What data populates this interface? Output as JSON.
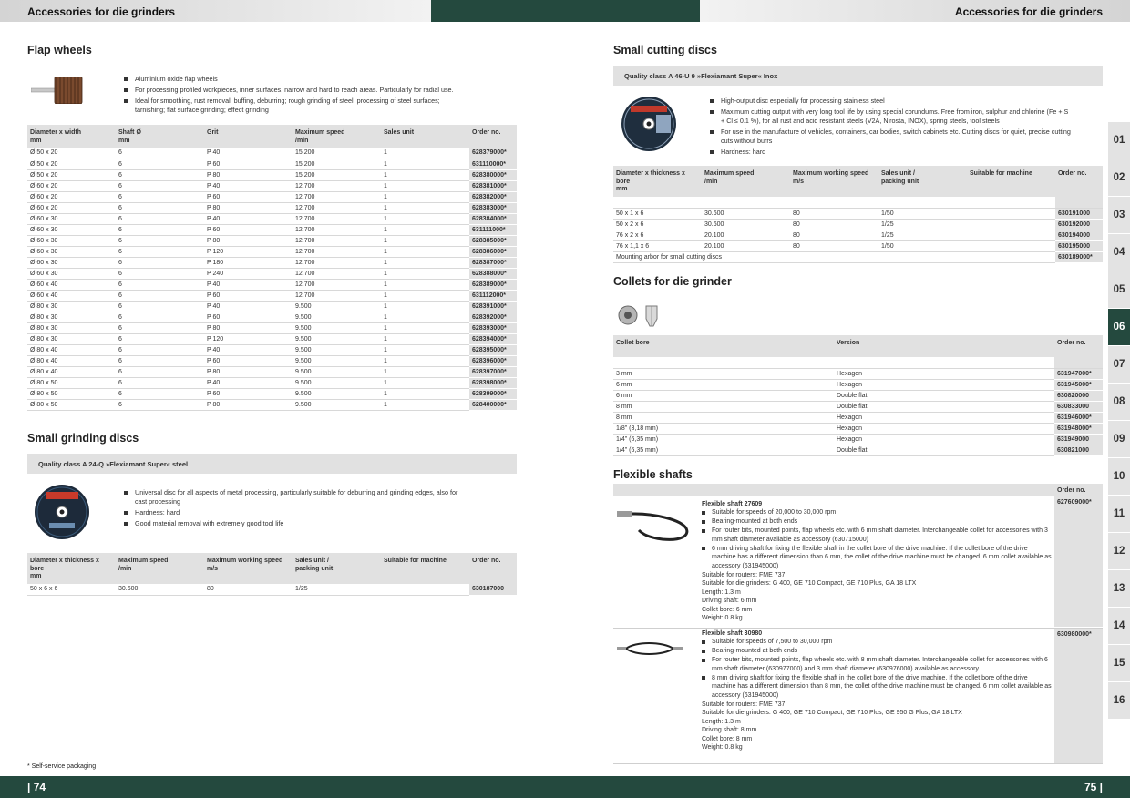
{
  "header": {
    "left_title": "Accessories for die grinders",
    "right_title": "Accessories for die grinders"
  },
  "footer": {
    "left_page": "| 74",
    "right_page": "75 |",
    "footnote": "* Self-service packaging"
  },
  "side_tabs": {
    "items": [
      "01",
      "02",
      "03",
      "04",
      "05",
      "06",
      "07",
      "08",
      "09",
      "10",
      "11",
      "12",
      "13",
      "14",
      "15",
      "16"
    ],
    "active": "06"
  },
  "flap_wheels": {
    "title": "Flap wheels",
    "bullets": [
      "Aluminium oxide flap wheels",
      "For processing profiled workpieces, inner surfaces, narrow and hard to reach areas. Particularly for radial use.",
      "Ideal for smoothing, rust removal, buffing, deburring; rough grinding of steel; processing of steel surfaces; tarnishing; flat surface grinding; effect grinding"
    ],
    "columns": [
      "Diameter x width\nmm",
      "Shaft Ø\nmm",
      "Grit",
      "Maximum speed\n/min",
      "Sales unit",
      "Order no."
    ],
    "rows": [
      [
        "Ø 50 x 20",
        "6",
        "P 40",
        "15.200",
        "1",
        "628379000*"
      ],
      [
        "Ø 50 x 20",
        "6",
        "P 60",
        "15.200",
        "1",
        "631110000*"
      ],
      [
        "Ø 50 x 20",
        "6",
        "P 80",
        "15.200",
        "1",
        "628380000*"
      ],
      [
        "Ø 60 x 20",
        "6",
        "P 40",
        "12.700",
        "1",
        "628381000*"
      ],
      [
        "Ø 60 x 20",
        "6",
        "P 60",
        "12.700",
        "1",
        "628382000*"
      ],
      [
        "Ø 60 x 20",
        "6",
        "P 80",
        "12.700",
        "1",
        "628383000*"
      ],
      [
        "Ø 60 x 30",
        "6",
        "P 40",
        "12.700",
        "1",
        "628384000*"
      ],
      [
        "Ø 60 x 30",
        "6",
        "P 60",
        "12.700",
        "1",
        "631111000*"
      ],
      [
        "Ø 60 x 30",
        "6",
        "P 80",
        "12.700",
        "1",
        "628385000*"
      ],
      [
        "Ø 60 x 30",
        "6",
        "P 120",
        "12.700",
        "1",
        "628386000*"
      ],
      [
        "Ø 60 x 30",
        "6",
        "P 180",
        "12.700",
        "1",
        "628387000*"
      ],
      [
        "Ø 60 x 30",
        "6",
        "P 240",
        "12.700",
        "1",
        "628388000*"
      ],
      [
        "Ø 60 x 40",
        "6",
        "P 40",
        "12.700",
        "1",
        "628389000*"
      ],
      [
        "Ø 60 x 40",
        "6",
        "P 60",
        "12.700",
        "1",
        "631112000*"
      ],
      [
        "Ø 80 x 30",
        "6",
        "P 40",
        "9.500",
        "1",
        "628391000*"
      ],
      [
        "Ø 80 x 30",
        "6",
        "P 60",
        "9.500",
        "1",
        "628392000*"
      ],
      [
        "Ø 80 x 30",
        "6",
        "P 80",
        "9.500",
        "1",
        "628393000*"
      ],
      [
        "Ø 80 x 30",
        "6",
        "P 120",
        "9.500",
        "1",
        "628394000*"
      ],
      [
        "Ø 80 x 40",
        "6",
        "P 40",
        "9.500",
        "1",
        "628395000*"
      ],
      [
        "Ø 80 x 40",
        "6",
        "P 60",
        "9.500",
        "1",
        "628396000*"
      ],
      [
        "Ø 80 x 40",
        "6",
        "P 80",
        "9.500",
        "1",
        "628397000*"
      ],
      [
        "Ø 80 x 50",
        "6",
        "P 40",
        "9.500",
        "1",
        "628398000*"
      ],
      [
        "Ø 80 x 50",
        "6",
        "P 60",
        "9.500",
        "1",
        "628399000*"
      ],
      [
        "Ø 80 x 50",
        "6",
        "P 80",
        "9.500",
        "1",
        "628400000*"
      ]
    ]
  },
  "small_grinding_discs": {
    "title": "Small grinding discs",
    "quality": "Quality class A 24-Q »Flexiamant Super« steel",
    "bullets": [
      "Universal disc for all aspects of metal processing, particularly suitable for deburring and grinding edges, also for cast processing",
      "Hardness: hard",
      "Good material removal with extremely good tool life"
    ],
    "columns": [
      "Diameter x thickness x\nbore\nmm",
      "Maximum speed\n/min",
      "Maximum working speed\nm/s",
      "Sales unit /\npacking unit",
      "Suitable for machine",
      "Order no."
    ],
    "rows": [
      [
        "50 x 6 x 6",
        "30.600",
        "80",
        "1/25",
        "",
        "630187000"
      ]
    ]
  },
  "small_cutting_discs": {
    "title": "Small cutting discs",
    "quality": "Quality class A 46-U 9 »Flexiamant Super« Inox",
    "bullets": [
      "High-output disc especially for processing stainless steel",
      "Maximum cutting output with very long tool life by using special corundums. Free from iron, sulphur and chlorine (Fe + S + Cl ≤ 0.1 %), for all rust and acid resistant steels (V2A, Nirosta, INOX), spring steels, tool steels",
      "For use in the manufacture of vehicles, containers, car bodies, switch cabinets etc. Cutting discs for quiet, precise cutting cuts without burrs",
      "Hardness: hard"
    ],
    "columns": [
      "Diameter x thickness x\nbore\nmm",
      "Maximum speed\n/min",
      "Maximum working speed\nm/s",
      "Sales unit /\npacking unit",
      "Suitable for machine",
      "Order no."
    ],
    "rows": [
      [
        "50 x 1 x 6",
        "30.600",
        "80",
        "1/50",
        "",
        "630191000"
      ],
      [
        "50 x 2 x 6",
        "30.600",
        "80",
        "1/25",
        "",
        "630192000"
      ],
      [
        "76 x 2 x 6",
        "20.100",
        "80",
        "1/25",
        "",
        "630194000"
      ],
      [
        "76 x 1,1 x 6",
        "20.100",
        "80",
        "1/50",
        "",
        "630195000"
      ]
    ],
    "arbor_label": "Mounting arbor for small cutting discs",
    "arbor_order": "630189000*"
  },
  "collets": {
    "title": "Collets for die grinder",
    "columns": [
      "Collet bore",
      "Version",
      "Order no."
    ],
    "rows": [
      [
        "3 mm",
        "Hexagon",
        "631947000*"
      ],
      [
        "6 mm",
        "Hexagon",
        "631945000*"
      ],
      [
        "6 mm",
        "Double flat",
        "630820000"
      ],
      [
        "8 mm",
        "Double flat",
        "630833000"
      ],
      [
        "8 mm",
        "Hexagon",
        "631946000*"
      ],
      [
        "1/8\" (3,18 mm)",
        "Hexagon",
        "631948000*"
      ],
      [
        "1/4\" (6,35 mm)",
        "Hexagon",
        "631949000"
      ],
      [
        "1/4\" (6,35 mm)",
        "Double flat",
        "630821000"
      ]
    ]
  },
  "flexible_shafts": {
    "title": "Flexible shafts",
    "order_header": "Order no.",
    "items": [
      {
        "name": "Flexible shaft 27609",
        "order": "627609000*",
        "bullets": [
          "Suitable for speeds of 20,000 to 30,000 rpm",
          "Bearing-mounted at both ends",
          "For router bits, mounted points, flap wheels etc. with 6 mm shaft diameter. Interchangeable collet for accessories with 3 mm shaft diameter available as accessory (630715000)",
          "6 mm driving shaft for fixing the flexible shaft in the collet bore of the drive machine. If the collet bore of the drive machine has a different dimension than 6 mm, the collet of the drive machine must be changed. 6 mm collet available as accessory (631945000)"
        ],
        "specs": [
          "Suitable for routers: FME 737",
          "Suitable for die grinders: G 400, GE 710 Compact, GE 710 Plus, GA 18 LTX",
          "Length: 1.3 m",
          "Driving shaft: 6 mm",
          "Collet bore: 6 mm",
          "Weight: 0.8 kg"
        ]
      },
      {
        "name": "Flexible shaft 30980",
        "order": "630980000*",
        "bullets": [
          "Suitable for speeds of 7,500 to 30,000 rpm",
          "Bearing-mounted at both ends",
          "For router bits, mounted points, flap wheels etc. with 8 mm shaft diameter. Interchangeable collet for accessories with 6 mm shaft diameter (630977000) and 3 mm shaft diameter (630976000) available as accessory",
          "8 mm driving shaft for fixing the flexible shaft in the collet bore of the drive machine. If the collet bore of the drive machine has a different dimension than 8 mm, the collet of the drive machine must be changed. 6 mm collet available as accessory (631945000)"
        ],
        "specs": [
          "Suitable for routers: FME 737",
          "Suitable for die grinders: G 400, GE 710 Compact, GE 710 Plus, GE 950 G Plus, GA 18 LTX",
          "Length: 1.3 m",
          "Driving shaft: 8 mm",
          "Collet bore: 8 mm",
          "Weight: 0.8 kg"
        ]
      }
    ]
  },
  "colors": {
    "dark_green": "#24493e",
    "grey_band": "#e1e1e1"
  }
}
